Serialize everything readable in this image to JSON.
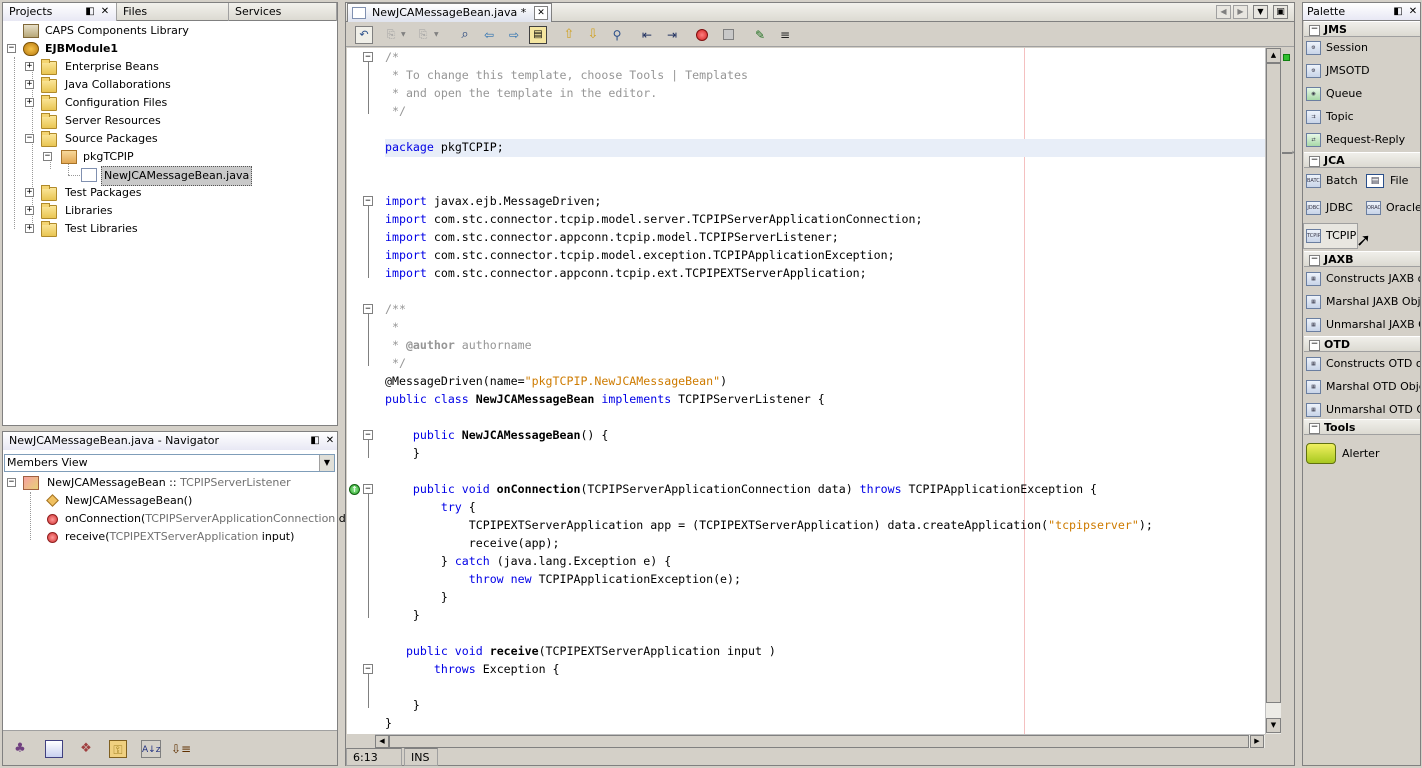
{
  "projects_panel": {
    "tabs": [
      "Projects",
      "Files",
      "Services"
    ],
    "tree": [
      {
        "label": "CAPS Components Library"
      },
      {
        "label": "EJBModule1"
      },
      {
        "label": "Enterprise Beans"
      },
      {
        "label": "Java Collaborations"
      },
      {
        "label": "Configuration Files"
      },
      {
        "label": "Server Resources"
      },
      {
        "label": "Source Packages"
      },
      {
        "label": "pkgTCPIP"
      },
      {
        "label": "NewJCAMessageBean.java"
      },
      {
        "label": "Test Packages"
      },
      {
        "label": "Libraries"
      },
      {
        "label": "Test Libraries"
      }
    ]
  },
  "navigator": {
    "title": "NewJCAMessageBean.java - Navigator",
    "view_select": "Members View",
    "class_name": "NewJCAMessageBean",
    "class_sep": " :: ",
    "class_super": "TCPIPServerListener",
    "members": [
      {
        "name": "NewJCAMessageBean()",
        "params": ""
      },
      {
        "name": "onConnection(",
        "params": "TCPIPServerApplicationConnection",
        "tail": " data)"
      },
      {
        "name": "receive(",
        "params": "TCPIPEXTServerApplication",
        "tail": " input)"
      }
    ]
  },
  "editor": {
    "tab_title": "NewJCAMessageBean.java *",
    "status_position": "6:13",
    "status_mode": "INS"
  },
  "palette": {
    "title": "Palette",
    "categories": [
      {
        "name": "JMS",
        "items": [
          "Session",
          "JMSOTD",
          "Queue",
          "Topic",
          "Request-Reply"
        ]
      },
      {
        "name": "JCA",
        "items": [
          "Batch",
          "File",
          "JDBC",
          "Oracle",
          "TCPIP"
        ]
      },
      {
        "name": "JAXB",
        "items": [
          "Constructs JAXB ob",
          "Marshal JAXB Objec",
          "Unmarshal JAXB Ob"
        ]
      },
      {
        "name": "OTD",
        "items": [
          "Constructs OTD obj",
          "Marshal OTD Object",
          "Unmarshal OTD Obj"
        ]
      },
      {
        "name": "Tools",
        "items": [
          "Alerter"
        ]
      }
    ],
    "icon_labels": {
      "batch": "BATCH",
      "jdbc": "JDBC",
      "oracle": "ORACLE",
      "tcpip": "TCPIP"
    }
  },
  "code": {
    "l1": "/*",
    "l2": " * To change this template, choose Tools | Templates",
    "l3": " * and open the template in the editor.",
    "l4": " */",
    "l6_kw": "package",
    "l6_rest": " pkgTCPIP;",
    "kw_import": "import",
    "imports": [
      " javax.ejb.MessageDriven;",
      " com.stc.connector.tcpip.model.server.TCPIPServerApplicationConnection;",
      " com.stc.connector.appconn.tcpip.model.TCPIPServerListener;",
      " com.stc.connector.tcpip.model.exception.TCPIPApplicationException;",
      " com.stc.connector.appconn.tcpip.ext.TCPIPEXTServerApplication;"
    ],
    "jd1": "/**",
    "jd2": " *",
    "jd3_pre": " * ",
    "jd3_tag": "@author",
    "jd3_rest": " authorname",
    "jd4": " */",
    "ann_pre": "@MessageDriven(name=",
    "ann_str": "\"pkgTCPIP.NewJCAMessageBean\"",
    "ann_post": ")",
    "cls_kw1": "public class",
    "cls_name": " NewJCAMessageBean",
    "cls_kw2": " implements",
    "cls_rest": " TCPIPServerListener {",
    "ctor_kw": "    public",
    "ctor_name": " NewJCAMessageBean",
    "ctor_rest": "() {",
    "close1": "    }",
    "oc_kw": "    public void",
    "oc_name": " onConnection",
    "oc_rest": "(TCPIPServerApplicationConnection data)",
    "oc_throws": " throws",
    "oc_exc": " TCPIPApplicationException {",
    "try_kw": "        try",
    "try_rest": " {",
    "app_pre": "            TCPIPEXTServerApplication app = (TCPIPEXTServerApplication) data.createApplication(",
    "app_str": "\"tcpipserver\"",
    "app_post": ");",
    "recv_call": "            receive(app);",
    "catch_pre": "        } ",
    "catch_kw": "catch",
    "catch_rest": " (java.lang.Exception e) {",
    "throw_kw": "            throw new",
    "throw_rest": " TCPIPApplicationException(e);",
    "close_try": "        }",
    "close_oc": "    }",
    "rc_kw": "   public void",
    "rc_name": " receive",
    "rc_rest": "(TCPIPEXTServerApplication input )",
    "rc_throws": "       throws",
    "rc_exc": " Exception {",
    "close_rc": "    }",
    "close_cls": "}"
  }
}
